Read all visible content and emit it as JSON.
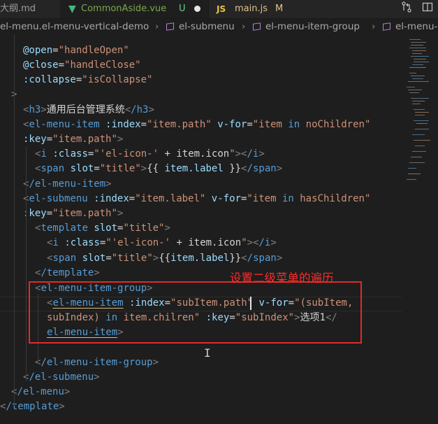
{
  "tabs": [
    {
      "name": "大纲.md",
      "status": "",
      "active": false
    },
    {
      "name": "CommonAside.vue",
      "status": "U",
      "active": true,
      "modified": true
    },
    {
      "name": "main.js",
      "status": "M",
      "active": false
    }
  ],
  "toolbar": {
    "compare_icon": "compare-changes-icon",
    "split_icon": "split-editor-icon"
  },
  "breadcrumb": [
    "el-menu.el-menu-vertical-demo",
    "el-submenu",
    "el-menu-item-group",
    "el-menu-"
  ],
  "annotation": "设置二级菜单的遍历",
  "code": {
    "l1": {
      "a": "@open",
      "v": "\"handleOpen\""
    },
    "l2": {
      "a": "@close",
      "v": "\"handleClose\""
    },
    "l3": {
      "a": ":collapse",
      "v": "\"isCollapse\""
    },
    "l4": ">",
    "l5": {
      "t": "h3",
      "text": "通用后台管理系统",
      "t2": "/h3"
    },
    "l6": {
      "t": "el-menu-item",
      "a1": ":index",
      "v1": "\"item.path\"",
      "a2": "v-for",
      "v2a": "\"item ",
      "kw": "in",
      "v2b": " noChildren\""
    },
    "l7": {
      "a": ":key",
      "v": "\"item.path\""
    },
    "l8": {
      "t": "i",
      "a": ":class",
      "v1": "\"'el-icon-'",
      "mid": " + item.icon",
      "v2": "\"",
      "t2": "/i"
    },
    "l9": {
      "t": "span",
      "a": "slot",
      "v": "\"title\"",
      "m1": "{{ ",
      "m2": "item.label",
      "m3": " }}",
      "t2": "/span"
    },
    "l10": {
      "t": "/el-menu-item"
    },
    "l11": {
      "t": "el-submenu",
      "a1": ":index",
      "v1": "\"item.label\"",
      "a2": "v-for",
      "v2a": "\"item ",
      "kw": "in",
      "v2b": " hasChildren\""
    },
    "l12": {
      "a": ":key",
      "v": "\"item.path\""
    },
    "l13": {
      "t": "template",
      "a": "slot",
      "v": "\"title\""
    },
    "l14": {
      "t": "i",
      "a": ":class",
      "v1": "\"'el-icon-'",
      "mid": " + item.icon",
      "v2": "\"",
      "t2": "/i"
    },
    "l15": {
      "t": "span",
      "a": "slot",
      "v": "\"title\"",
      "m1": "{{",
      "m2": "item.label",
      "m3": "}}",
      "t2": "/span"
    },
    "l16": {
      "t": "/template"
    },
    "l17": {
      "t": "el-menu-item-group"
    },
    "l18": {
      "t": "el-menu-item",
      "a1": ":index",
      "v1": "\"subItem.path\"",
      "a2": "v-for",
      "v2": "\"(subItem,"
    },
    "l19": {
      "v1": "subIndex) ",
      "kw": "in",
      "v2": " item.chilren\"",
      "a": ":key",
      "v3": "\"subIndex\"",
      "text": "选项1",
      "t2": "/"
    },
    "l20": {
      "t": "el-menu-item"
    },
    "l21": {
      "t": "/el-menu-item-group"
    },
    "l22": {
      "t": "/el-submenu"
    },
    "l23": {
      "t": "/el-menu"
    },
    "l24": {
      "t": "/template"
    }
  },
  "colors": {
    "annotation": "#ff2a2a",
    "box": "#e02b2b",
    "vue": "#41b883",
    "js": "#e8c547"
  }
}
